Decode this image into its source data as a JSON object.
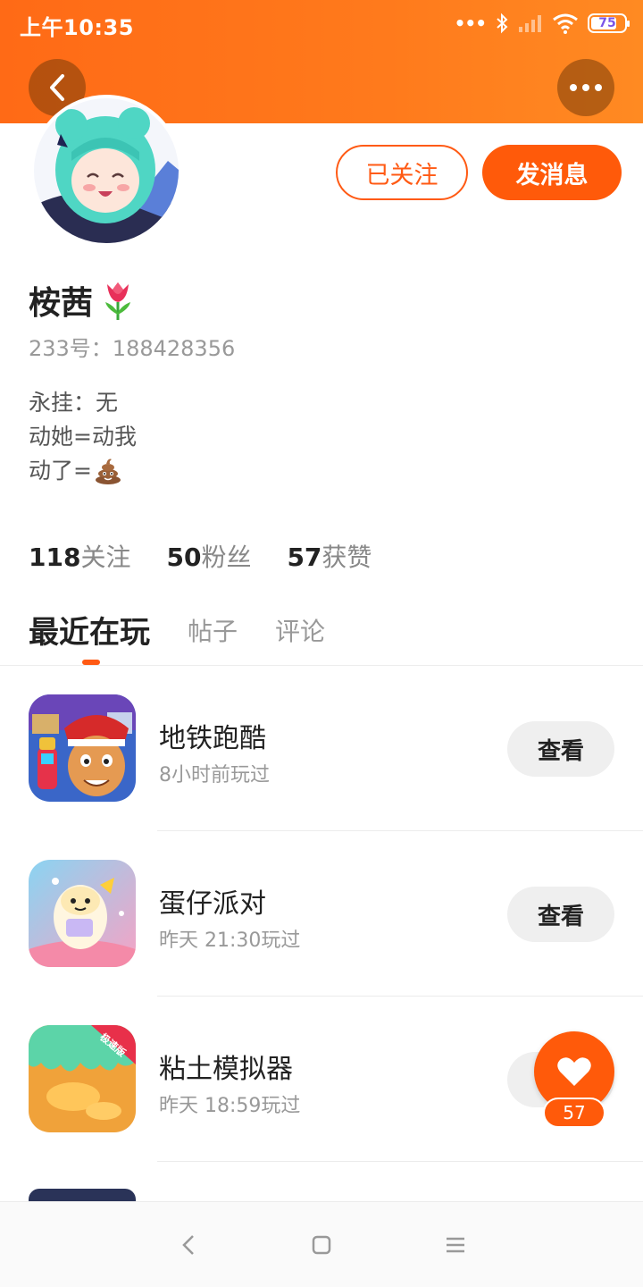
{
  "status_bar": {
    "time": "上午10:35",
    "signal_dots": "•••",
    "battery_level": "75"
  },
  "header": {
    "back_icon": "chevron-left-icon",
    "more_icon": "more-horizontal-icon"
  },
  "profile": {
    "name": "桉茜",
    "name_emoji": "tulip",
    "account_id": "233号：188428356",
    "bio": [
      "永挂：无",
      "动她=动我",
      "动了="
    ],
    "bio_emoji": "poop",
    "followed_label": "已关注",
    "message_label": "发消息"
  },
  "stats": [
    {
      "value": "118",
      "label": "关注"
    },
    {
      "value": "50",
      "label": "粉丝"
    },
    {
      "value": "57",
      "label": "获赞"
    }
  ],
  "tabs": [
    {
      "label": "最近在玩",
      "active": true
    },
    {
      "label": "帖子",
      "active": false
    },
    {
      "label": "评论",
      "active": false
    }
  ],
  "games": [
    {
      "name": "地铁跑酷",
      "time": "8小时前玩过",
      "button": "查看"
    },
    {
      "name": "蛋仔派对",
      "time": "昨天 21:30玩过",
      "button": "查看"
    },
    {
      "name": "粘土模拟器",
      "time": "昨天 18:59玩过",
      "button": "查看",
      "badge": "极速版"
    }
  ],
  "like_fab": {
    "icon": "heart-icon",
    "count": "57"
  },
  "colors": {
    "accent": "#ff5a14",
    "header_orange": "#ff7a1c",
    "muted_text": "#999999"
  }
}
